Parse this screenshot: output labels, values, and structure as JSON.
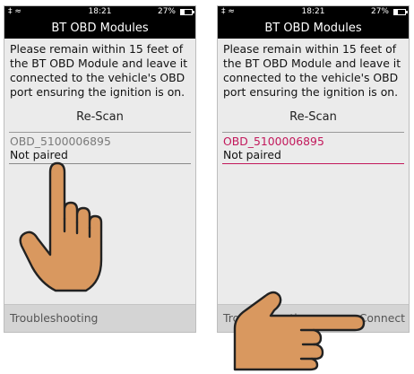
{
  "status": {
    "time": "18:21",
    "battery": "27%",
    "battery_level_percent": 27
  },
  "screen": {
    "title": "BT OBD Modules",
    "instructions": "Please remain within 15 feet of the BT OBD Module and leave it connected to the vehicle's OBD port ensuring the ignition is on.",
    "rescan_label": "Re-Scan",
    "device": {
      "name": "OBD_5100006895",
      "status": "Not paired"
    },
    "troubleshooting_label": "Troubleshooting",
    "connect_label": "Connect"
  },
  "colors": {
    "selected": "#c2185b",
    "hand": "#d9985f",
    "title_bar": "#000000",
    "footer": "#d4d4d4"
  },
  "icons": [
    "bluetooth-signal-icon",
    "wifi-icon",
    "battery-icon",
    "pointing-hand-icon"
  ]
}
